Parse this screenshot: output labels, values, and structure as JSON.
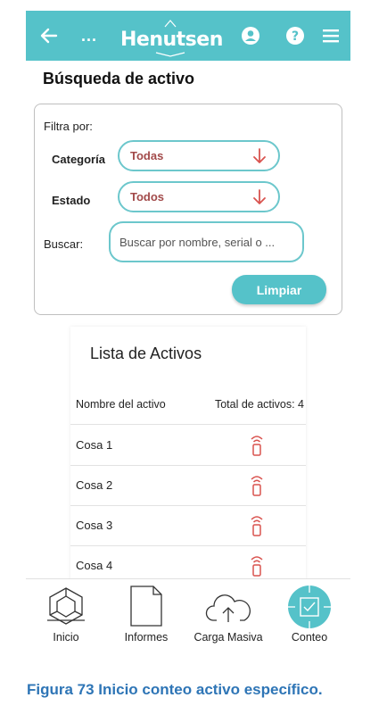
{
  "header": {
    "logo_text": "Henutsen",
    "more_label": "...",
    "bg_color": "#55c2c9"
  },
  "page": {
    "title": "Búsqueda de activo"
  },
  "filter": {
    "label": "Filtra por:",
    "category_label": "Categoría",
    "category_value": "Todas",
    "state_label": "Estado",
    "state_value": "Todos",
    "search_label": "Buscar:",
    "search_placeholder": "Buscar por nombre, serial o ...",
    "clear_label": "Limpiar"
  },
  "list": {
    "title": "Lista de Activos",
    "col_name": "Nombre del activo",
    "col_total": "Total de activos: 4",
    "items": [
      {
        "name": "Cosa 1",
        "icon": "rfid-tag-icon"
      },
      {
        "name": "Cosa 2",
        "icon": "rfid-tag-icon"
      },
      {
        "name": "Cosa 3",
        "icon": "rfid-tag-icon"
      },
      {
        "name": "Cosa 4",
        "icon": "rfid-tag-icon"
      }
    ]
  },
  "nav": [
    {
      "label": "Inicio",
      "icon": "cube-icon"
    },
    {
      "label": "Informes",
      "icon": "document-icon"
    },
    {
      "label": "Carga Masiva",
      "icon": "cloud-upload-icon"
    },
    {
      "label": "Conteo",
      "icon": "count-target-icon"
    }
  ],
  "caption": "Figura 73 Inicio conteo activo específico.",
  "colors": {
    "accent": "#55c2c9",
    "select_text": "#a24a4a",
    "icon_red": "#d9534f",
    "caption": "#2e75b6"
  }
}
